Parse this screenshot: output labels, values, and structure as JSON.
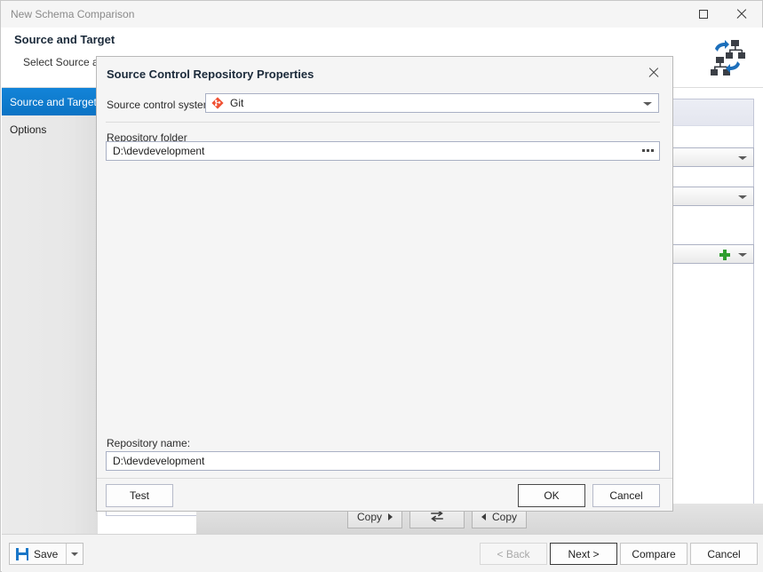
{
  "window": {
    "title": "New Schema Comparison",
    "maximize_icon": "maximize-icon",
    "close_icon": "close-icon",
    "header_icon": "schema-compare-icon"
  },
  "header": {
    "title": "Source and Target",
    "subtitle": "Select Source and"
  },
  "sidebar": {
    "items": [
      {
        "label": "Source and Target",
        "selected": true
      },
      {
        "label": "Options",
        "selected": false
      }
    ]
  },
  "copy_toolbar": {
    "copy_right_label": "Copy",
    "swap_icon": "swap-icon",
    "copy_left_label": "Copy"
  },
  "footer": {
    "save_label": "Save",
    "save_icon": "save-floppy-icon",
    "save_dropdown_icon": "chevron-down-icon",
    "back_label": "< Back",
    "next_label": "Next >",
    "compare_label": "Compare",
    "cancel_label": "Cancel"
  },
  "dialog": {
    "title": "Source Control Repository Properties",
    "close_icon": "close-icon",
    "source_control_system": {
      "label": "Source control system:",
      "value": "Git",
      "icon": "git-icon",
      "dropdown_icon": "chevron-down-icon"
    },
    "repository_folder": {
      "label": "Repository folder",
      "value": "D:\\devdevelopment",
      "browse_icon": "ellipsis-browse-icon"
    },
    "repository_name": {
      "label": "Repository name:",
      "value": "D:\\devdevelopment"
    },
    "buttons": {
      "test_label": "Test",
      "ok_label": "OK",
      "cancel_label": "Cancel"
    }
  },
  "colors": {
    "accent": "#0b73c4",
    "git_orange": "#f05133",
    "save_blue": "#1976c8",
    "plus_green": "#2f9e2f"
  }
}
